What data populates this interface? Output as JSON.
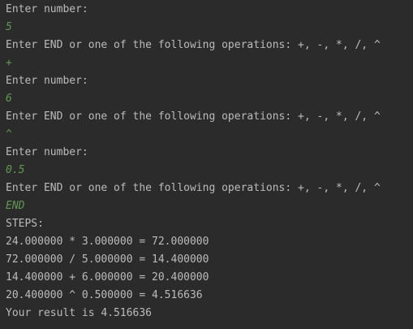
{
  "console": {
    "colors": {
      "background": "#2b2b2b",
      "output_text": "#bbbbbb",
      "user_input": "#629755"
    },
    "lines": [
      {
        "text": "Enter number:",
        "kind": "output"
      },
      {
        "text": "5",
        "kind": "input"
      },
      {
        "text": "Enter END or one of the following operations: +, -, *, /, ^",
        "kind": "output"
      },
      {
        "text": "+",
        "kind": "input"
      },
      {
        "text": "Enter number:",
        "kind": "output"
      },
      {
        "text": "6",
        "kind": "input"
      },
      {
        "text": "Enter END or one of the following operations: +, -, *, /, ^",
        "kind": "output"
      },
      {
        "text": "^",
        "kind": "input"
      },
      {
        "text": "Enter number:",
        "kind": "output"
      },
      {
        "text": "0.5",
        "kind": "input"
      },
      {
        "text": "Enter END or one of the following operations: +, -, *, /, ^",
        "kind": "output"
      },
      {
        "text": "END",
        "kind": "input"
      },
      {
        "text": "STEPS:",
        "kind": "output"
      },
      {
        "text": "24.000000 * 3.000000 = 72.000000",
        "kind": "output"
      },
      {
        "text": "72.000000 / 5.000000 = 14.400000",
        "kind": "output"
      },
      {
        "text": "14.400000 + 6.000000 = 20.400000",
        "kind": "output"
      },
      {
        "text": "20.400000 ^ 0.500000 = 4.516636",
        "kind": "output"
      },
      {
        "text": "Your result is 4.516636",
        "kind": "output"
      }
    ]
  }
}
